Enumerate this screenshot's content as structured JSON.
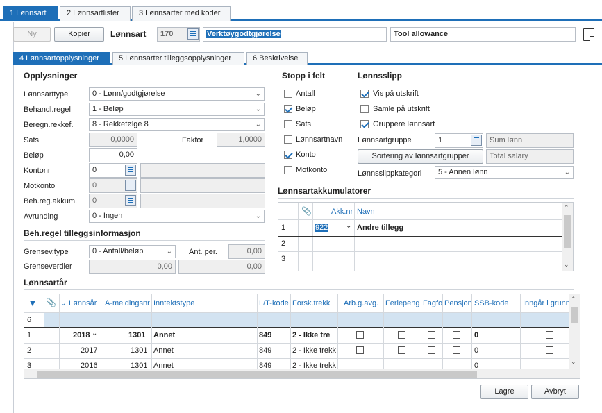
{
  "top_tabs": [
    "1 Lønnsart",
    "2 Lønnsartlister",
    "3 Lønnsarter med koder"
  ],
  "toolbar": {
    "new_label": "Ny",
    "copy_label": "Kopier",
    "lonnsart_label": "Lønnsart",
    "lonnsart_number": "170",
    "name_no": "Verktøygodtgjørelse",
    "name_en": "Tool allowance"
  },
  "sub_tabs": [
    "4 Lønnsartopplysninger",
    "5 Lønnsarter tilleggsopplysninger",
    "6 Beskrivelse"
  ],
  "opplysninger": {
    "title": "Opplysninger",
    "lonnsarttype_label": "Lønnsarttype",
    "lonnsarttype_value": "0 - Lønn/godtgjørelse",
    "behandl_label": "Behandl.regel",
    "behandl_value": "1 - Beløp",
    "beregn_label": "Beregn.rekkef.",
    "beregn_value": "8 - Rekkefølge 8",
    "sats_label": "Sats",
    "sats_value": "0,0000",
    "faktor_label": "Faktor",
    "faktor_value": "1,0000",
    "belop_label": "Beløp",
    "belop_value": "0,00",
    "kontonr_label": "Kontonr",
    "kontonr_value": "0",
    "motkonto_label": "Motkonto",
    "motkonto_value": "0",
    "behreg_label": "Beh.reg.akkum.",
    "behreg_value": "0",
    "avrunding_label": "Avrunding",
    "avrunding_value": "0 - Ingen"
  },
  "tillegg": {
    "title": "Beh.regel tilleggsinformasjon",
    "grensev_label": "Grensev.type",
    "grensev_value": "0 - Antall/beløp",
    "antper_label": "Ant. per.",
    "antper_value": "0,00",
    "grenseverdier_label": "Grenseverdier",
    "grense1": "0,00",
    "grense2": "0,00"
  },
  "stopp": {
    "title": "Stopp i felt",
    "items": [
      {
        "label": "Antall",
        "checked": false
      },
      {
        "label": "Beløp",
        "checked": true
      },
      {
        "label": "Sats",
        "checked": false
      },
      {
        "label": "Lønnsartnavn",
        "checked": false
      },
      {
        "label": "Konto",
        "checked": true
      },
      {
        "label": "Motkonto",
        "checked": false
      }
    ]
  },
  "lonnsslipp": {
    "title": "Lønnsslipp",
    "vis_label": "Vis på utskrift",
    "samle_label": "Samle på utskrift",
    "gruppere_label": "Gruppere lønnsart",
    "gruppe_label": "Lønnsartgruppe",
    "gruppe_value": "1",
    "sum_lonn": "Sum lønn",
    "sortering_button": "Sortering av lønnsartgrupper",
    "total_salary": "Total salary",
    "kategori_label": "Lønnsslippkategori",
    "kategori_value": "5 - Annen lønn"
  },
  "akkumulatorer": {
    "title": "Lønnsartakkumulatorer",
    "col_akknr": "Akk.nr",
    "col_navn": "Navn",
    "rows": [
      {
        "num": "1",
        "akknr": "922",
        "navn": "Andre tillegg"
      },
      {
        "num": "2",
        "akknr": "",
        "navn": ""
      },
      {
        "num": "3",
        "akknr": "",
        "navn": ""
      }
    ]
  },
  "lonnsartar": {
    "title": "Lønnsartår",
    "columns": [
      "Lønnsår",
      "A-meldingsnr",
      "Inntektstype",
      "L/T-kode",
      "Forsk.trekk",
      "Arb.g.avg.",
      "Feriepeng",
      "Fagfo",
      "Pensjon",
      "SSB-kode",
      "Inngår i grunnl"
    ],
    "filter_row_num": "6",
    "rows": [
      {
        "num": "1",
        "year": "2018",
        "amelding": "1301",
        "inntekt": "Annet",
        "lt": "849",
        "forsk": "2 - Ikke tre",
        "ssb": "0"
      },
      {
        "num": "2",
        "year": "2017",
        "amelding": "1301",
        "inntekt": "Annet",
        "lt": "849",
        "forsk": "2 - Ikke trekk",
        "ssb": "0"
      },
      {
        "num": "3",
        "year": "2016",
        "amelding": "1301",
        "inntekt": "Annet",
        "lt": "849",
        "forsk": "2 - Ikke trekk",
        "ssb": "0"
      }
    ]
  },
  "footer": {
    "save_label": "Lagre",
    "cancel_label": "Avbryt"
  },
  "colors": {
    "accent": "#1e6fb8"
  }
}
